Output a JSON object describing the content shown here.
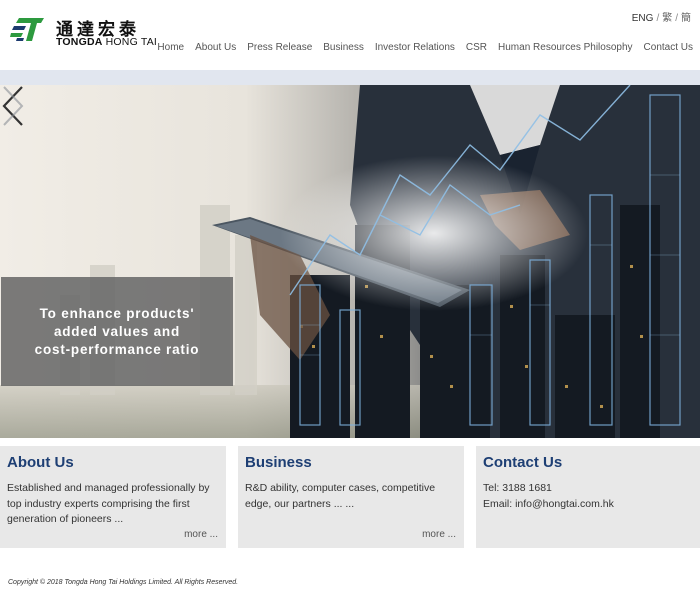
{
  "logo": {
    "chinese": "通達宏泰",
    "english_bold": "TONGDA",
    "english_rest": "HONG TAI"
  },
  "lang": {
    "eng": "ENG",
    "trad": "繁",
    "simp": "簡",
    "sep": "/"
  },
  "nav": {
    "home": "Home",
    "about": "About Us",
    "press": "Press Release",
    "business": "Business",
    "investor": "Investor Relations",
    "csr": "CSR",
    "hr": "Human Resources Philosophy",
    "contact": "Contact Us"
  },
  "hero": {
    "caption_line1": "To enhance products'",
    "caption_line2": "added values and",
    "caption_line3": "cost-performance ratio"
  },
  "cards": {
    "about": {
      "title": "About Us",
      "text": "Established and managed professionally by top industry experts comprising the first generation of pioneers ...",
      "more": "more ..."
    },
    "business": {
      "title": "Business",
      "text": "R&D ability, computer cases, competitive edge, our partners ... ...",
      "more": "more ..."
    },
    "contact": {
      "title": "Contact Us",
      "tel": "Tel: 3188 1681",
      "email": "Email: info@hongtai.com.hk"
    }
  },
  "footer": {
    "copyright": "Copyright © 2018 Tongda Hong Tai Holdings Limited. All Rights Reserved."
  },
  "colors": {
    "title_blue": "#1e3f74",
    "logo_green": "#2d9a3f",
    "logo_navy": "#1c3a6e",
    "band": "#e1e6ef"
  }
}
